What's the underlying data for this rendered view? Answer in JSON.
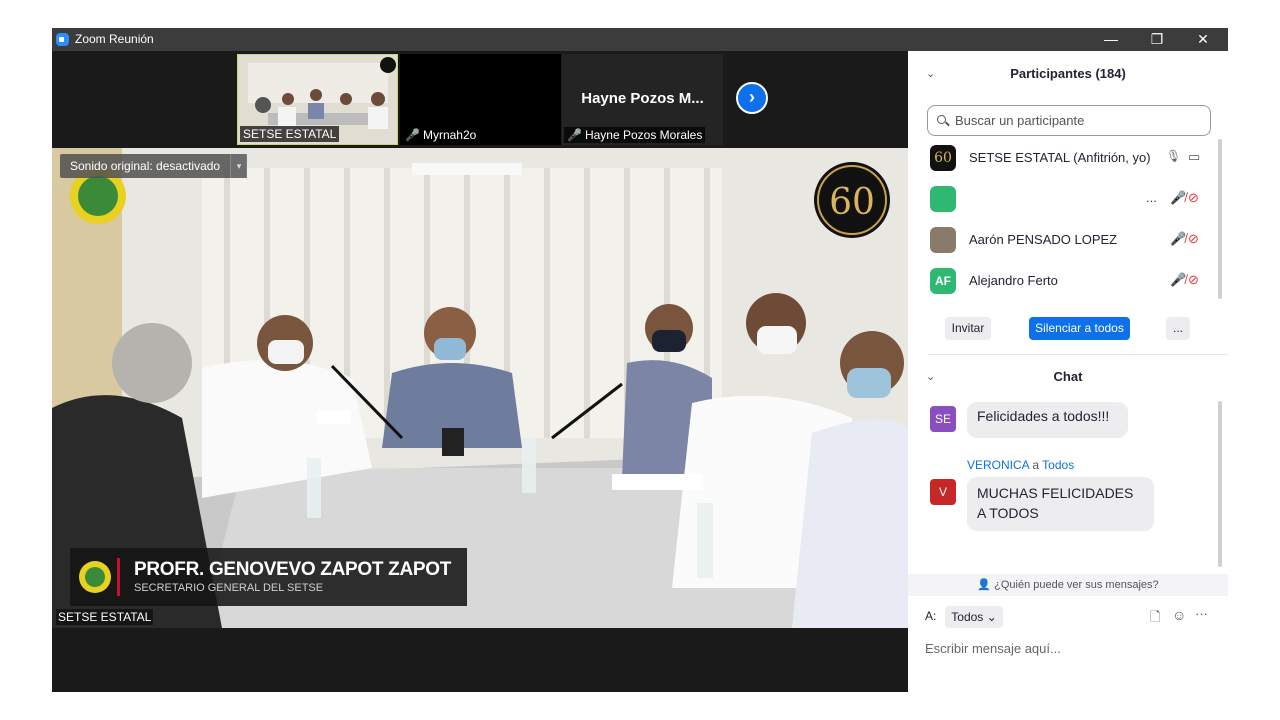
{
  "window": {
    "title": "Zoom Reunión",
    "min": "—",
    "max": "❐",
    "close": "✕"
  },
  "thumbnails": [
    {
      "name": "SETSE ESTATAL",
      "muted": false
    },
    {
      "name": "Myrnah2o",
      "muted": true
    },
    {
      "name": "Hayne  Pozos Morales",
      "display": "Hayne  Pozos M...",
      "muted": true
    }
  ],
  "next_arrow": "›",
  "main_video": {
    "sound_toggle": "Sonido original: desactivado",
    "caret": "▾",
    "lower_third_name": "PROFR. GENOVEVO ZAPOT ZAPOT",
    "lower_third_title": "SECRETARIO GENERAL DEL SETSE",
    "participant_label": "SETSE ESTATAL",
    "badge_number": "60"
  },
  "participants": {
    "header": "Participantes (184)",
    "search_placeholder": "Buscar un participante",
    "list": [
      {
        "name": "SETSE ESTATAL (Anfitrión, yo)",
        "avatar_text": "60",
        "avatar_color": "#111111",
        "mic": "🎙",
        "video": "▭"
      },
      {
        "name": "",
        "avatar_text": "",
        "avatar_color": "#2eb872",
        "extra": "..."
      },
      {
        "name": "Aarón PENSADO LOPEZ",
        "avatar_text": "",
        "avatar_color": "#8a7a6a"
      },
      {
        "name": "Alejandro Ferto",
        "avatar_text": "AF",
        "avatar_color": "#2eb872"
      }
    ],
    "invite": "Invitar",
    "mute_all": "Silenciar a todos",
    "more": "..."
  },
  "chat": {
    "header": "Chat",
    "messages": [
      {
        "avatar": "SE",
        "avatar_color": "#8a4fbf",
        "text": "Felicidades a todos!!!"
      },
      {
        "avatar": "V",
        "avatar_color": "#c62828",
        "sender": "VERONICA",
        "to_word": "a",
        "to": "Todos",
        "text": "MUCHAS FELICIDADES A TODOS"
      }
    ],
    "who_can_see": "¿Quién puede ver sus mensajes?",
    "to_label": "A:",
    "to_value": "Todos",
    "placeholder": "Escribir mensaje aquí...",
    "more": "···"
  },
  "colors": {
    "accent": "#0e71eb",
    "muted": "#e8323c",
    "green_avatar": "#2eb872"
  }
}
